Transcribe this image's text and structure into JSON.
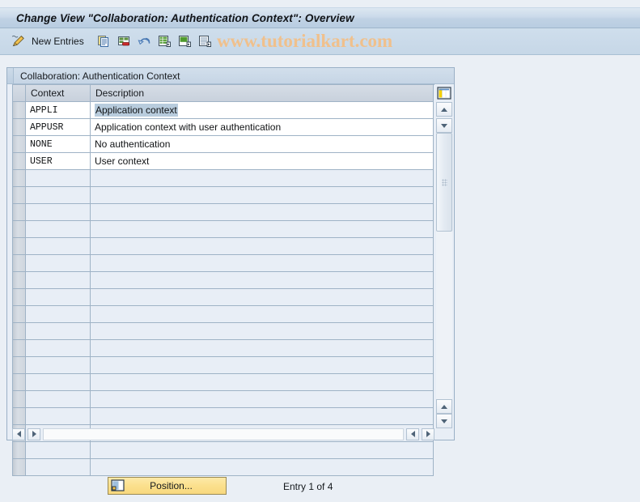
{
  "window": {
    "title": "Change View \"Collaboration: Authentication Context\": Overview"
  },
  "toolbar": {
    "edit_icon": "pencil-icon",
    "new_entries_label": "New Entries",
    "icons": [
      {
        "name": "copy-as-icon",
        "title": "Copy As..."
      },
      {
        "name": "delete-icon",
        "title": "Delete"
      },
      {
        "name": "undo-icon",
        "title": "Undo Change"
      },
      {
        "name": "select-all-icon",
        "title": "Select All"
      },
      {
        "name": "select-block-icon",
        "title": "Select Block"
      },
      {
        "name": "deselect-all-icon",
        "title": "Deselect All"
      }
    ]
  },
  "watermark": {
    "text": "www.tutorialkart.com",
    "color": "#f0c08c"
  },
  "panel": {
    "header": "Collaboration: Authentication Context"
  },
  "table": {
    "columns": [
      "Context",
      "Description"
    ],
    "rows": [
      {
        "context": "APPLI",
        "description": "Application context"
      },
      {
        "context": "APPUSR",
        "description": "Application context with user authentication"
      },
      {
        "context": "NONE",
        "description": "No authentication"
      },
      {
        "context": "USER",
        "description": "User context"
      }
    ],
    "selected_cell": {
      "row": 0,
      "column": "Description"
    },
    "empty_row_count": 18,
    "config_icon": "table-settings-icon"
  },
  "scrollbars": {
    "vertical": {
      "up_icon": "triangle-up-icon",
      "down_icon": "triangle-down-icon",
      "grip_icon": "grip-dots-icon"
    },
    "horizontal": {
      "left_icon": "triangle-left-icon",
      "right_icon": "triangle-right-icon"
    }
  },
  "footer": {
    "position_button_label": "Position...",
    "position_button_icon": "position-icon",
    "entry_status": "Entry 1 of 4"
  },
  "colors": {
    "title_bar": "#c6d6e6",
    "toolbar": "#cbdaea",
    "panel_bg": "#e8eef6",
    "grid_line": "#9fb3c6",
    "selection": "#b8ccdd",
    "button_yellow": "#fbe08d"
  }
}
